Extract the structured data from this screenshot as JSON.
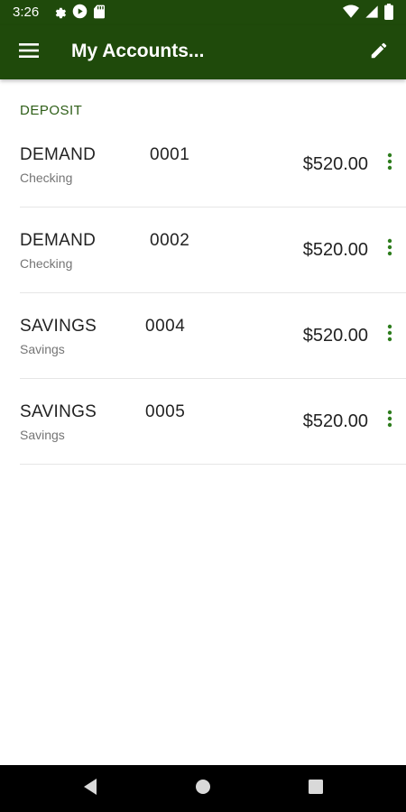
{
  "status_bar": {
    "time": "3:26",
    "icons_left": [
      "gear-icon",
      "play-icon",
      "sd-card-icon"
    ],
    "icons_right": [
      "wifi-icon",
      "signal-icon",
      "battery-icon"
    ]
  },
  "app_bar": {
    "title": "My Accounts...",
    "menu_icon": "hamburger-menu-icon",
    "edit_icon": "pencil-edit-icon",
    "background_color": "#1f4a0b"
  },
  "section": {
    "header": "DEPOSIT"
  },
  "accounts": [
    {
      "name": "DEMAND",
      "number": "0001",
      "type": "Checking",
      "balance": "$520.00"
    },
    {
      "name": "DEMAND",
      "number": "0002",
      "type": "Checking",
      "balance": "$520.00"
    },
    {
      "name": "SAVINGS",
      "number": "0004",
      "type": "Savings",
      "balance": "$520.00"
    },
    {
      "name": "SAVINGS",
      "number": "0005",
      "type": "Savings",
      "balance": "$520.00"
    }
  ],
  "colors": {
    "primary": "#1f4a0b",
    "accent": "#2e7d1e",
    "section_header": "#2e5e17"
  },
  "nav_bar": {
    "icons": [
      "back-icon",
      "home-icon",
      "recents-icon"
    ]
  }
}
